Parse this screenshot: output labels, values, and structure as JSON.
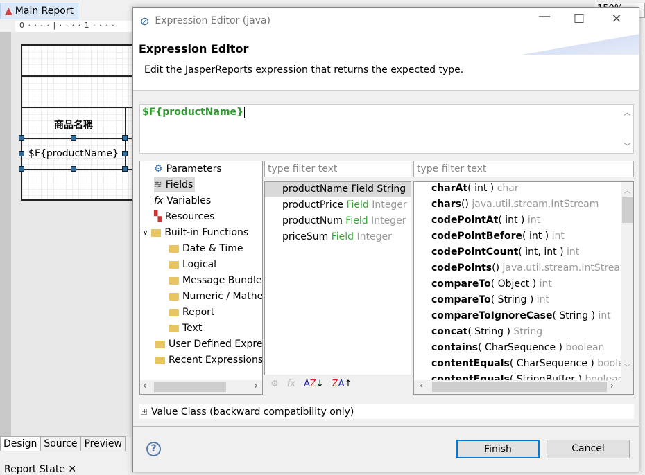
{
  "background": {
    "editor_tab": "Main Report",
    "ruler_text": "0 · · · · | · · · · 1 · · · ·",
    "zoom": "150%",
    "static_label": "商品名稱",
    "field_label": "$F{productName}",
    "bottom_tabs": [
      "Design",
      "Source",
      "Preview"
    ],
    "report_state_tab": "Report State"
  },
  "dialog": {
    "window_title": "Expression Editor (java)",
    "title": "Expression Editor",
    "description": "Edit the JasperReports expression that returns the expected type.",
    "expression": "$F{productName}",
    "tree": [
      {
        "label": "Parameters",
        "icon": "parameters-icon"
      },
      {
        "label": "Fields",
        "icon": "fields-icon",
        "selected": true
      },
      {
        "label": "Variables",
        "icon": "variables-icon"
      },
      {
        "label": "Resources",
        "icon": "resources-icon"
      },
      {
        "label": "Built-in Functions",
        "icon": "folder-icon",
        "expanded": true
      },
      {
        "label": "Date & Time",
        "icon": "folder-icon",
        "child": true
      },
      {
        "label": "Logical",
        "icon": "folder-icon",
        "child": true
      },
      {
        "label": "Message Bundles",
        "icon": "folder-icon",
        "child": true
      },
      {
        "label": "Numeric / Mathe",
        "icon": "folder-icon",
        "child": true
      },
      {
        "label": "Report",
        "icon": "folder-icon",
        "child": true
      },
      {
        "label": "Text",
        "icon": "folder-icon",
        "child": true
      },
      {
        "label": "User Defined Expres",
        "icon": "folder-icon"
      },
      {
        "label": "Recent Expressions",
        "icon": "folder-icon"
      }
    ],
    "filter_placeholder": "type filter text",
    "fields": [
      {
        "name": "productName",
        "kind": "Field",
        "type": "String",
        "selected": true
      },
      {
        "name": "productPrice",
        "kind": "Field",
        "type": "Integer"
      },
      {
        "name": "productNum",
        "kind": "Field",
        "type": "Integer"
      },
      {
        "name": "priceSum",
        "kind": "Field",
        "type": "Integer"
      }
    ],
    "methods": [
      {
        "name": "charAt",
        "args": "( int )",
        "ret": "char"
      },
      {
        "name": "chars",
        "args": "()",
        "ret": "java.util.stream.IntStream"
      },
      {
        "name": "codePointAt",
        "args": "( int )",
        "ret": "int"
      },
      {
        "name": "codePointBefore",
        "args": "( int )",
        "ret": "int"
      },
      {
        "name": "codePointCount",
        "args": "( int, int )",
        "ret": "int"
      },
      {
        "name": "codePoints",
        "args": "()",
        "ret": "java.util.stream.IntStream"
      },
      {
        "name": "compareTo",
        "args": "( Object )",
        "ret": "int"
      },
      {
        "name": "compareTo",
        "args": "( String )",
        "ret": "int"
      },
      {
        "name": "compareToIgnoreCase",
        "args": "( String )",
        "ret": "int"
      },
      {
        "name": "concat",
        "args": "( String )",
        "ret": "String"
      },
      {
        "name": "contains",
        "args": "( CharSequence )",
        "ret": "boolean"
      },
      {
        "name": "contentEquals",
        "args": "( CharSequence )",
        "ret": "boolean"
      },
      {
        "name": "contentEquals",
        "args": "( StringBuffer )",
        "ret": "boolean"
      }
    ],
    "value_class": "Value Class (backward compatibility only)",
    "finish": "Finish",
    "cancel": "Cancel",
    "help": "?"
  },
  "colors": {
    "expression": "#2a9a2a",
    "field_kind": "#3aa63a",
    "accent": "#0078d7"
  }
}
